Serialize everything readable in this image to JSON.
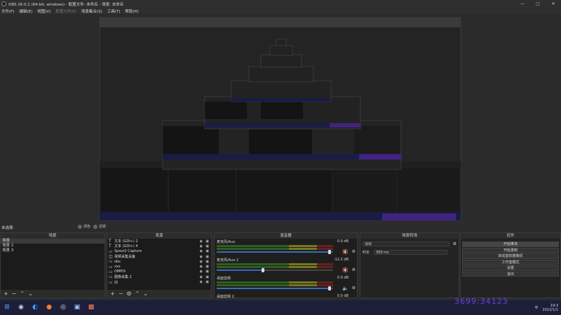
{
  "window": {
    "title": "OBS 26.0.2 (64-bit, windows) - 配置文件: 未命名 - 场景: 未命名"
  },
  "menu": [
    {
      "label": "文件(F)",
      "enabled": true
    },
    {
      "label": "编辑(E)",
      "enabled": true
    },
    {
      "label": "视图(V)",
      "enabled": true
    },
    {
      "label": "配置文件(P)",
      "enabled": false
    },
    {
      "label": "场景集合(S)",
      "enabled": true
    },
    {
      "label": "工具(T)",
      "enabled": true
    },
    {
      "label": "帮助(H)",
      "enabled": true
    }
  ],
  "preview": {
    "scene_label": "未选择",
    "studio_mode": "调色",
    "filters": "滤镜"
  },
  "scenes": {
    "title": "场景",
    "items": [
      "场景",
      "场景 2",
      "场景 3"
    ],
    "selected": 0
  },
  "sources": {
    "title": "来源",
    "items": [
      {
        "icon": "text-icon",
        "glyph": "T",
        "name": "文本 (GDI+) 2"
      },
      {
        "icon": "text-icon",
        "glyph": "T",
        "name": "文本 (GDI+) 4"
      },
      {
        "icon": "capture-icon",
        "glyph": "▭",
        "name": "Spout2 Capture"
      },
      {
        "icon": "video-device-icon",
        "glyph": "◫",
        "name": "视频采集设备"
      },
      {
        "icon": "media-icon",
        "glyph": "▭",
        "name": "obs"
      },
      {
        "icon": "media-icon",
        "glyph": "▭",
        "name": "xxx"
      },
      {
        "icon": "image-icon",
        "glyph": "▭",
        "name": "OMPIX"
      },
      {
        "icon": "image-icon",
        "glyph": "▭",
        "name": "图像采集 2"
      },
      {
        "icon": "image-icon",
        "glyph": "▭",
        "name": "旧"
      }
    ]
  },
  "mixer": {
    "title": "混音器",
    "tracks": [
      {
        "name": "麦克风/Aux",
        "db": "0.0 dB",
        "level": 0.97,
        "muted": true
      },
      {
        "name": "麦克风/Aux 2",
        "db": "-12.2 dB",
        "level": 0.4,
        "muted": true
      },
      {
        "name": "桌面音频",
        "db": "0.0 dB",
        "level": 0.97,
        "muted": false
      },
      {
        "name": "桌面音频 2",
        "db": "0.0 dB",
        "level": 0.97,
        "muted": false
      }
    ]
  },
  "transitions": {
    "title": "场景转场",
    "selected": "淡出",
    "duration_label": "时长",
    "duration": "300 ms"
  },
  "controls": {
    "title": "控件",
    "buttons": [
      "开始推流",
      "开始录制",
      "启动虚拟摄像机",
      "工作室模式",
      "设置",
      "退出"
    ],
    "active": 0
  },
  "taskbar": {
    "apps": [
      {
        "icon": "windows-start-icon",
        "glyph": "⊞",
        "color": "#5aa0ff"
      },
      {
        "icon": "steam-icon",
        "glyph": "◉",
        "color": "#c8d0e0"
      },
      {
        "icon": "edge-icon",
        "glyph": "◐",
        "color": "#3ea6ff"
      },
      {
        "icon": "firefox-icon",
        "glyph": "●",
        "color": "#ff7a2a"
      },
      {
        "icon": "obs-icon",
        "glyph": "◎",
        "color": "#e0e0e0"
      },
      {
        "icon": "remote-desktop-icon",
        "glyph": "▣",
        "color": "#9ec3ff"
      },
      {
        "icon": "paint-icon",
        "glyph": "▩",
        "color": "#ff7a5a"
      }
    ],
    "tray_lang": "中",
    "tray_time": "19:3",
    "tray_date": "2022/1/1"
  },
  "watermark": "3699:34123"
}
